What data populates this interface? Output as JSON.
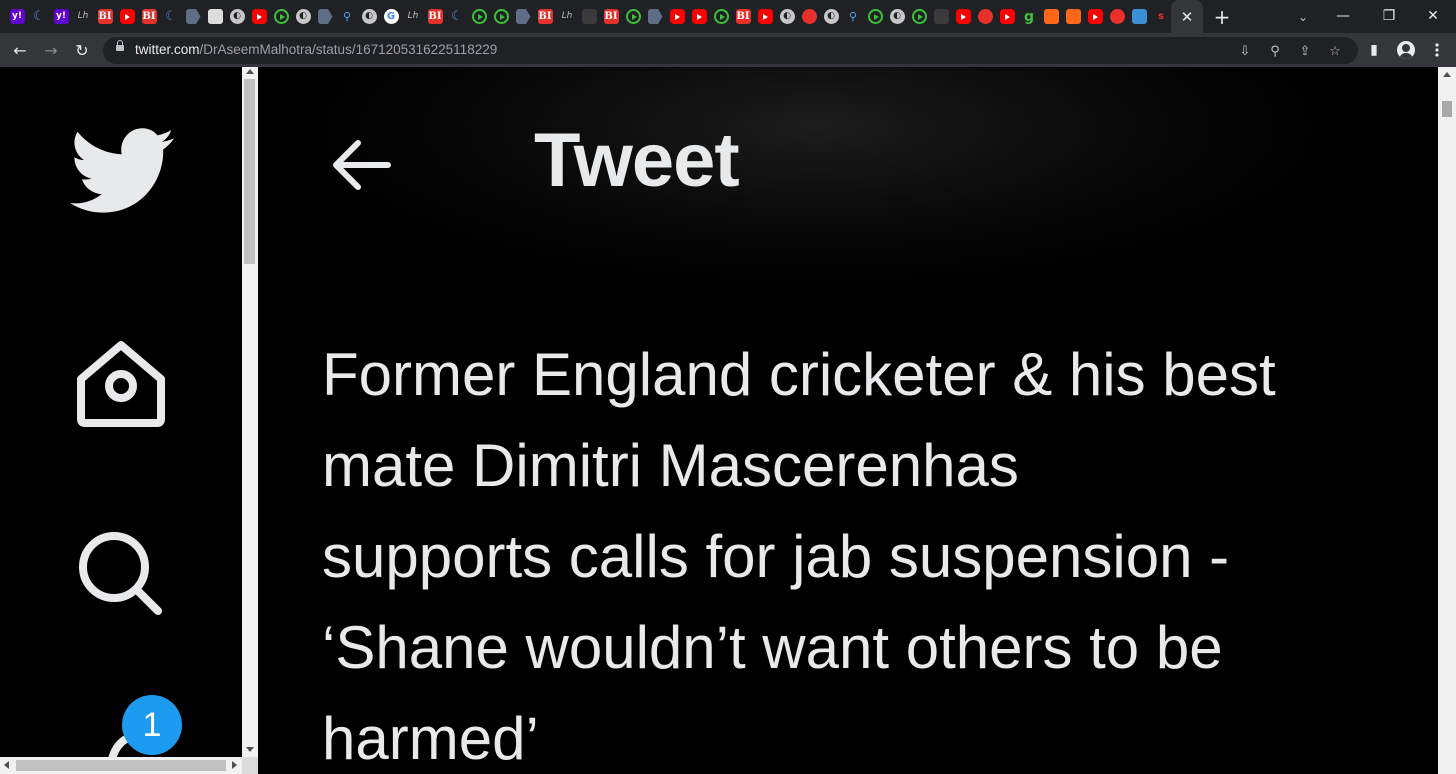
{
  "browser": {
    "pinned_tabs": [
      {
        "icon": "yahoo-icon",
        "label": "y!",
        "kind": "yahoo"
      },
      {
        "icon": "moon-icon",
        "label": "☾",
        "kind": "moon"
      },
      {
        "icon": "yahoo-icon",
        "label": "y!",
        "kind": "yahoo"
      },
      {
        "icon": "lh-icon",
        "label": "Lh",
        "kind": "lh"
      },
      {
        "icon": "business-insider-icon",
        "label": "BI",
        "kind": "bi"
      },
      {
        "icon": "youtube-icon",
        "label": "",
        "kind": "yt"
      },
      {
        "icon": "business-insider-icon",
        "label": "BI",
        "kind": "bi"
      },
      {
        "icon": "moon-icon",
        "label": "☾",
        "kind": "moon"
      },
      {
        "icon": "document-icon",
        "label": "",
        "kind": "doc"
      },
      {
        "icon": "image-icon",
        "label": "",
        "kind": "img"
      },
      {
        "icon": "globe-icon",
        "label": "◐",
        "kind": "globe"
      },
      {
        "icon": "youtube-icon",
        "label": "",
        "kind": "yt"
      },
      {
        "icon": "play-icon",
        "label": "",
        "kind": "play"
      },
      {
        "icon": "globe-icon",
        "label": "◐",
        "kind": "globe"
      },
      {
        "icon": "document-icon",
        "label": "",
        "kind": "doc"
      },
      {
        "icon": "search-icon",
        "label": "⚲",
        "kind": "search"
      },
      {
        "icon": "globe-icon",
        "label": "◐",
        "kind": "globe"
      },
      {
        "icon": "google-icon",
        "label": "G",
        "kind": "g"
      },
      {
        "icon": "lh-icon",
        "label": "Lh",
        "kind": "lh"
      },
      {
        "icon": "business-insider-icon",
        "label": "BI",
        "kind": "bi"
      },
      {
        "icon": "moon-icon",
        "label": "☾",
        "kind": "moon"
      },
      {
        "icon": "play-icon",
        "label": "",
        "kind": "play"
      },
      {
        "icon": "play-icon",
        "label": "",
        "kind": "play"
      },
      {
        "icon": "document-icon",
        "label": "",
        "kind": "doc"
      },
      {
        "icon": "business-insider-icon",
        "label": "BI",
        "kind": "bi"
      },
      {
        "icon": "lh-icon",
        "label": "Lh",
        "kind": "lh"
      },
      {
        "icon": "dark-icon",
        "label": "",
        "kind": "dark"
      },
      {
        "icon": "business-insider-icon",
        "label": "BI",
        "kind": "bi"
      },
      {
        "icon": "play-icon",
        "label": "",
        "kind": "play"
      },
      {
        "icon": "document-icon",
        "label": "",
        "kind": "doc"
      },
      {
        "icon": "youtube-icon",
        "label": "",
        "kind": "yt"
      },
      {
        "icon": "youtube-icon",
        "label": "",
        "kind": "yt"
      },
      {
        "icon": "play-icon",
        "label": "",
        "kind": "play"
      },
      {
        "icon": "business-insider-icon",
        "label": "BI",
        "kind": "bi"
      },
      {
        "icon": "youtube-icon",
        "label": "",
        "kind": "yt"
      },
      {
        "icon": "globe-icon",
        "label": "◐",
        "kind": "globe"
      },
      {
        "icon": "microphone-icon",
        "label": "",
        "kind": "mic"
      },
      {
        "icon": "globe-icon",
        "label": "◐",
        "kind": "globe"
      },
      {
        "icon": "search-icon",
        "label": "⚲",
        "kind": "search"
      },
      {
        "icon": "play-icon",
        "label": "",
        "kind": "play"
      },
      {
        "icon": "globe-icon",
        "label": "◐",
        "kind": "globe"
      },
      {
        "icon": "play-icon",
        "label": "",
        "kind": "play"
      },
      {
        "icon": "dark-icon",
        "label": "",
        "kind": "dark"
      },
      {
        "icon": "youtube-icon",
        "label": "",
        "kind": "yt"
      },
      {
        "icon": "microphone-icon",
        "label": "",
        "kind": "mic"
      },
      {
        "icon": "youtube-icon",
        "label": "",
        "kind": "yt"
      },
      {
        "icon": "green-g-icon",
        "label": "g",
        "kind": "green9"
      },
      {
        "icon": "substack-icon",
        "label": "",
        "kind": "stack"
      },
      {
        "icon": "substack-icon",
        "label": "",
        "kind": "stack"
      },
      {
        "icon": "youtube-icon",
        "label": "",
        "kind": "yt"
      },
      {
        "icon": "microphone-icon",
        "label": "",
        "kind": "mic"
      },
      {
        "icon": "flag-icon",
        "label": "",
        "kind": "flag"
      },
      {
        "icon": "substack-red-icon",
        "label": "s",
        "kind": "sub"
      }
    ],
    "active_tab_close": "✕",
    "new_tab": "+",
    "tab_search": "⌄",
    "window_controls": {
      "minimize": "—",
      "restore": "❐",
      "close": "✕"
    },
    "nav": {
      "back": "←",
      "forward": "→",
      "reload": "↻"
    },
    "url": {
      "host": "twitter.com",
      "path": "/DrAseemMalhotra/status/1671205316225118229"
    },
    "omnibox_icons": {
      "install": "⇩",
      "zoom": "⚲",
      "share": "⇪",
      "bookmark": "☆"
    },
    "toolbar_icons": {
      "sidepanel": "▮"
    }
  },
  "sidebar": {
    "notification_count": "1"
  },
  "tweet": {
    "header_title": "Tweet",
    "text": "Former England cricketer & his best\nmate Dimitri Mascerenhas\nsupports calls for jab suspension -\n‘Shane wouldn’t want others to be\nharmed’"
  },
  "colors": {
    "background": "#000000",
    "text": "#e7e9ea",
    "badge": "#1d9bf0",
    "chrome_dark": "#202124",
    "chrome_toolbar": "#35363a"
  }
}
